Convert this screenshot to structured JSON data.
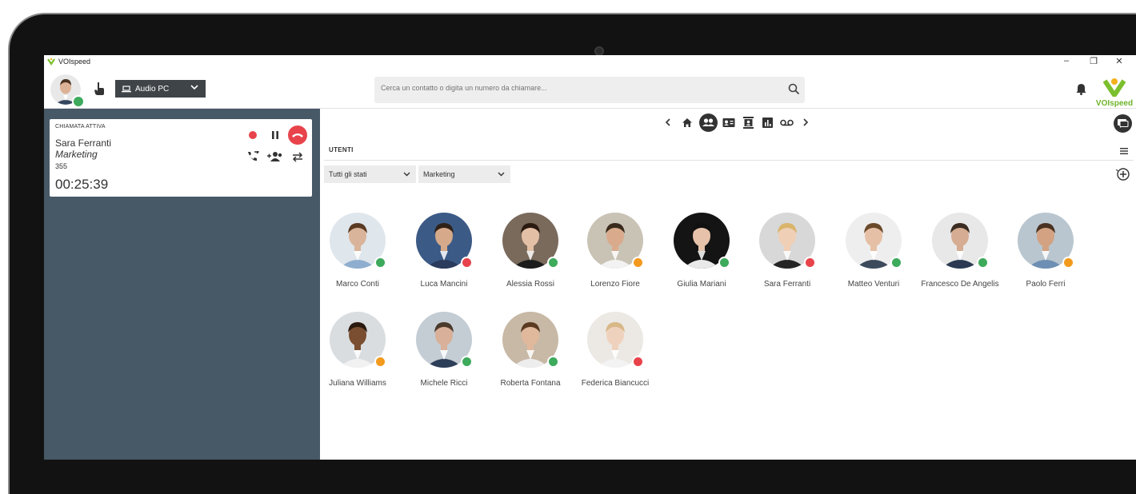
{
  "app": {
    "title": "VOIspeed",
    "brand_name": "VOIspeed",
    "brand_color": "#6fb42c"
  },
  "window_controls": {
    "minimize": "–",
    "restore": "❐",
    "close": "✕"
  },
  "header": {
    "audio_device": "Audio PC",
    "search_placeholder": "Cerca un contatto o digita un numero da chiamare..."
  },
  "call": {
    "label": "CHIAMATA ATTIVA",
    "name": "Sara Ferranti",
    "department": "Marketing",
    "extension": "355",
    "timer": "00:25:39"
  },
  "users_section": {
    "title": "UTENTI",
    "status_filter": "Tutti gli stati",
    "group_filter": "Marketing"
  },
  "status_colors": {
    "online": "#3daa5c",
    "busy": "#e8434b",
    "away": "#f39a1e"
  },
  "users": [
    {
      "name": "Marco Conti",
      "status": "online",
      "skin": "#d9b49a",
      "hair": "#5a3a22",
      "shirt": "#8faecf",
      "bg": "#dfe6ec"
    },
    {
      "name": "Luca Mancini",
      "status": "busy",
      "skin": "#d6a98a",
      "hair": "#2e2118",
      "shirt": "#2a3b5c",
      "bg": "#3c5a86"
    },
    {
      "name": "Alessia Rossi",
      "status": "online",
      "skin": "#e3bfa6",
      "hair": "#2b1a10",
      "shirt": "#1c1c1c",
      "bg": "#7a6a5c"
    },
    {
      "name": "Lorenzo Fiore",
      "status": "away",
      "skin": "#d9ab8c",
      "hair": "#3a2a1c",
      "shirt": "#f2f2f2",
      "bg": "#c9c3b6"
    },
    {
      "name": "Giulia Mariani",
      "status": "online",
      "skin": "#e6c2aa",
      "hair": "#111111",
      "shirt": "#e9e9e9",
      "bg": "#141414"
    },
    {
      "name": "Sara Ferranti",
      "status": "busy",
      "skin": "#efcfb6",
      "hair": "#d9b46a",
      "shirt": "#252525",
      "bg": "#d8d8d8"
    },
    {
      "name": "Matteo Venturi",
      "status": "online",
      "skin": "#e6c0a6",
      "hair": "#6b4a2c",
      "shirt": "#3c4a5c",
      "bg": "#eeeeee"
    },
    {
      "name": "Francesco De Angelis",
      "status": "online",
      "skin": "#d6ad92",
      "hair": "#3a2c22",
      "shirt": "#2b3a52",
      "bg": "#e8e8e8"
    },
    {
      "name": "Paolo Ferri",
      "status": "away",
      "skin": "#d2a283",
      "hair": "#4a3222",
      "shirt": "#6d8fb3",
      "bg": "#b9c6cf"
    },
    {
      "name": "Juliana Williams",
      "status": "away",
      "skin": "#7a4e30",
      "hair": "#2a1a10",
      "shirt": "#f1f1f1",
      "bg": "#d9dde0"
    },
    {
      "name": "Michele Ricci",
      "status": "online",
      "skin": "#d9b09a",
      "hair": "#4a3a2c",
      "shirt": "#2c3e58",
      "bg": "#c4ccd4"
    },
    {
      "name": "Roberta Fontana",
      "status": "online",
      "skin": "#e0b89c",
      "hair": "#5a3a22",
      "shirt": "#ededed",
      "bg": "#c8b9a6"
    },
    {
      "name": "Federica Biancucci",
      "status": "busy",
      "skin": "#efd2bd",
      "hair": "#d9b888",
      "shirt": "#f3f3f3",
      "bg": "#ece9e4"
    }
  ]
}
